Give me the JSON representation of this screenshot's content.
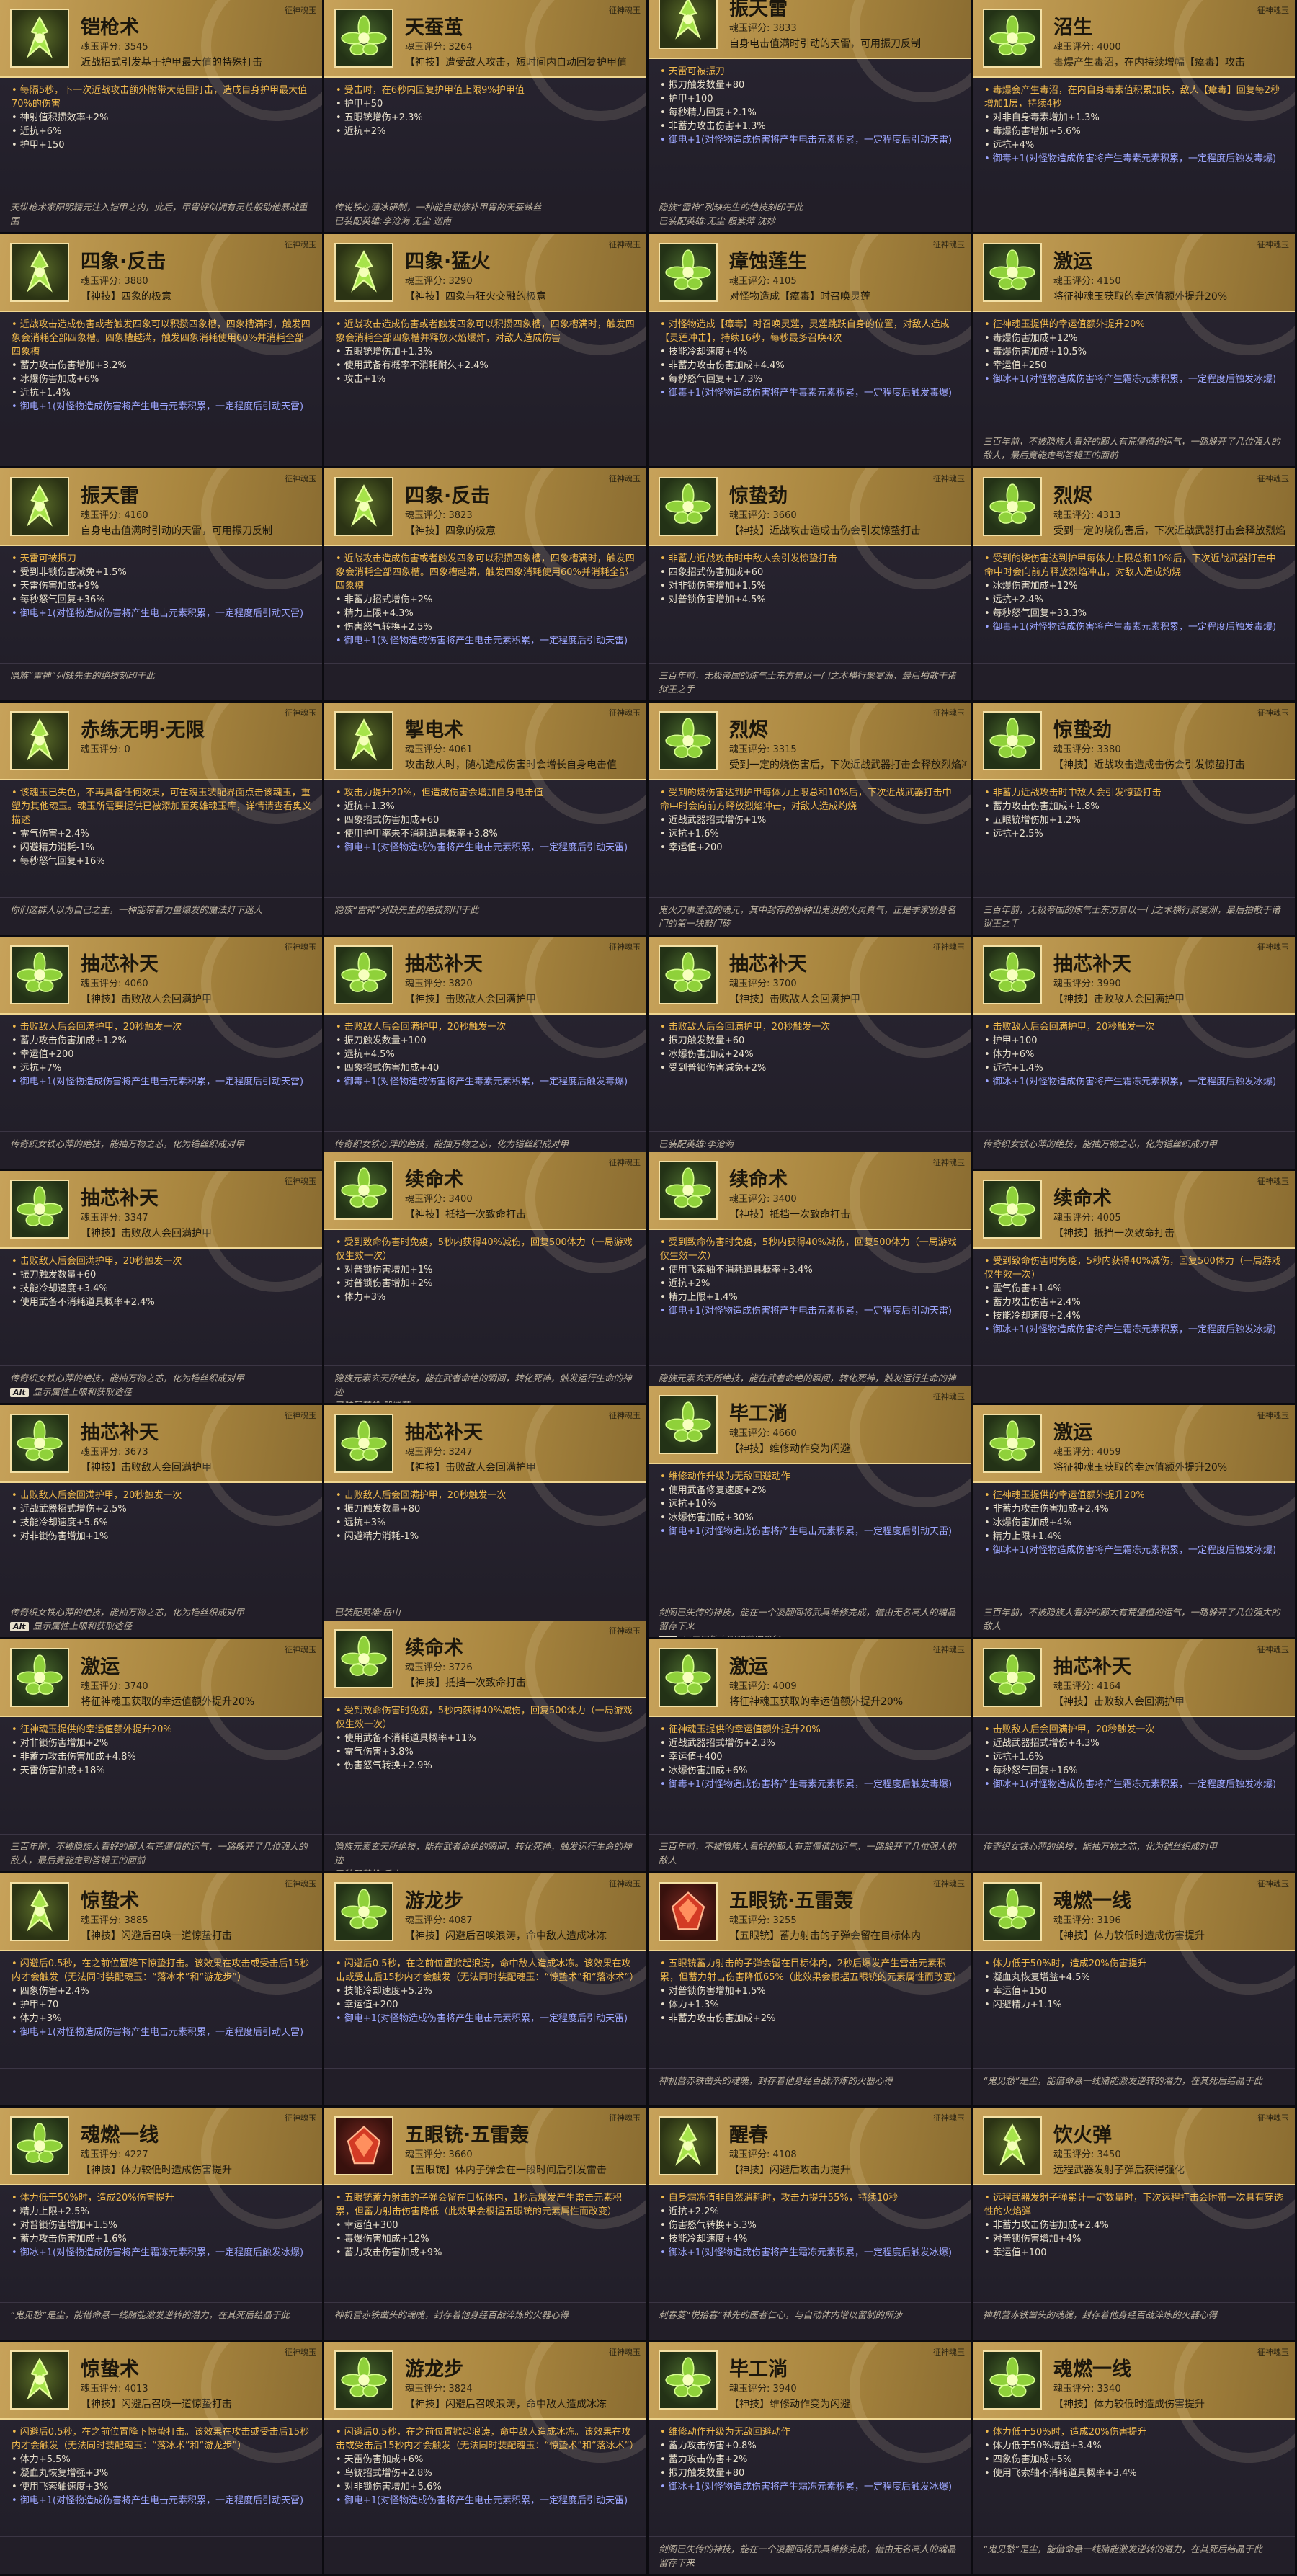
{
  "common": {
    "quality_tag": "征神魂玉",
    "alt_key": "Alt",
    "alt_hint": "显示属性上限和获取途径",
    "equip_prefix": "已装配英雄:"
  },
  "tiles": [
    {
      "name": "铠枪术",
      "score": "魂玉评分: 3545",
      "skill": "近战招式引发基于护甲最大值的特殊打击",
      "desc": "• 每隔5秒，下一次近战攻击额外附带大范围打击，造成自身护甲最大值70%的伤害",
      "lines": [
        "• 神射值积攒效率+2%",
        "• 近抗+6%",
        "• 护甲+150"
      ],
      "special": "",
      "lore": "天纵枪术家阳明精元注入铠甲之内，此后，甲胄好似拥有灵性般助他暴战重围",
      "icon": "spear"
    },
    {
      "name": "天蚕茧",
      "score": "魂玉评分: 3264",
      "skill": "【神技】遭受敌人攻击，短时间内自动回复护甲值",
      "desc": "• 受击时，在6秒内回复护甲值上限9%护甲值",
      "lines": [
        "• 护甲+50",
        "• 五眼铳增伤+2.3%",
        "• 近抗+2%"
      ],
      "special": "",
      "lore": "传说铁心薄冰研制，一种能自动修补甲胄的天蚕蛛丝",
      "equip": "李沧海 无尘 迦南",
      "icon": "flower"
    },
    {
      "name": "振天雷",
      "score": "魂玉评分: 3833",
      "skill": "自身电击值满时引动的天雷，可用振刀反制",
      "desc": "• 天雷可被振刀",
      "lines": [
        "• 振刀触发数量+80",
        "• 护甲+100",
        "• 每秒精力回复+2.1%",
        "• 非蓄力攻击伤害+1.3%"
      ],
      "special": "• 御电+1(对怪物造成伤害将产生电击元素积累，一定程度后引动天雷)",
      "lore": "隐族“雷神”列缺先生的绝技刻印于此",
      "equip": "无尘 殷紫萍 沈妙",
      "icon": "spear",
      "shift": true
    },
    {
      "name": "沼生",
      "score": "魂玉评分: 4000",
      "skill": "毒爆产生毒沼，在内持续增幅【瘴毒】攻击",
      "desc": "• 毒爆会产生毒沼，在内自身毒素值积累加快，敌人【瘴毒】回复每2秒增加1层，持续4秒",
      "lines": [
        "• 对非自身毒素增加+1.3%",
        "• 毒爆伤害增加+5.6%",
        "• 远抗+4%"
      ],
      "special": "• 御毒+1(对怪物造成伤害将产生毒素元素积累，一定程度后触发毒爆)",
      "lore": "",
      "icon": "flower"
    },
    {
      "name": "四象·反击",
      "score": "魂玉评分: 3880",
      "skill": "【神技】四象的极意",
      "desc": "• 近战攻击造成伤害或者触发四象可以积攒四象槽，四象槽满时，触发四象会消耗全部四象槽。四象槽越满，触发四象消耗使用60%并消耗全部四象槽",
      "lines": [
        "• 蓄力攻击伤害增加+3.2%",
        "• 冰爆伤害加成+6%",
        "• 近抗+1.4%"
      ],
      "special": "• 御电+1(对怪物造成伤害将产生电击元素积累，一定程度后引动天雷)",
      "lore": "",
      "icon": "spear"
    },
    {
      "name": "四象·猛火",
      "score": "魂玉评分: 3290",
      "skill": "【神技】四象与狂火交融的极意",
      "desc": "• 近战攻击造成伤害或者触发四象可以积攒四象槽，四象槽满时，触发四象会消耗全部四象槽并释放火焰爆炸，对敌人造成伤害",
      "lines": [
        "• 五眼铳增伤加+1.3%",
        "• 使用武备有概率不消耗耐久+2.4%",
        "• 攻击+1%"
      ],
      "special": "",
      "lore": "",
      "icon": "spear"
    },
    {
      "name": "瘴蚀莲生",
      "score": "魂玉评分: 4105",
      "skill": "对怪物造成【瘴毒】时召唤灵莲",
      "desc": "• 对怪物造成【瘴毒】时召唤灵莲，灵莲跳跃自身的位置，对敌人造成【灵莲冲击】，持续16秒，每秒最多召唤4次",
      "lines": [
        "• 技能冷却速度+4%",
        "• 非蓄力攻击伤害加成+4.4%",
        "• 每秒怒气回复+17.3%"
      ],
      "special": "• 御毒+1(对怪物造成伤害将产生毒素元素积累，一定程度后触发毒爆)",
      "lore": "",
      "icon": "flower"
    },
    {
      "name": "激运",
      "score": "魂玉评分: 4150",
      "skill": "将征神魂玉获取的幸运值额外提升20%",
      "desc": "• 征神魂玉提供的幸运值额外提升20%",
      "lines": [
        "• 毒爆伤害加成+12%",
        "• 毒爆伤害加成+10.5%",
        "• 幸运值+250"
      ],
      "special": "• 御冰+1(对怪物造成伤害将产生霜冻元素积累，一定程度后触发冰爆)",
      "lore": "三百年前，不被隐族人看好的鄙大有荒僵值的运气，一路躲开了几位强大的敌人，最后竟能走到答镜王的面前",
      "icon": "flower"
    },
    {
      "name": "振天雷",
      "score": "魂玉评分: 4160",
      "skill": "自身电击值满时引动的天雷，可用振刀反制",
      "desc": "• 天雷可被振刀",
      "lines": [
        "• 受到非锁伤害减免+1.5%",
        "• 天雷伤害加成+9%",
        "• 每秒怒气回复+36%"
      ],
      "special": "• 御电+1(对怪物造成伤害将产生电击元素积累，一定程度后引动天雷)",
      "lore": "隐族“雷神”列缺先生的绝技刻印于此",
      "icon": "spear"
    },
    {
      "name": "四象·反击",
      "score": "魂玉评分: 3823",
      "skill": "【神技】四象的极意",
      "desc": "• 近战攻击造成伤害或者触发四象可以积攒四象槽，四象槽满时，触发四象会消耗全部四象槽。四象槽越满，触发四象消耗使用60%并消耗全部四象槽",
      "lines": [
        "• 非蓄力招式增伤+2%",
        "• 精力上限+4.3%",
        "• 伤害怒气转换+2.5%"
      ],
      "special": "• 御电+1(对怪物造成伤害将产生电击元素积累，一定程度后引动天雷)",
      "lore": "",
      "icon": "spear"
    },
    {
      "name": "惊蛰劲",
      "score": "魂玉评分: 3660",
      "skill": "【神技】近战攻击造成击伤会引发惊蛰打击",
      "desc": "• 非蓄力近战攻击时中敌人会引发惊蛰打击",
      "lines": [
        "• 四象招式伤害加成+60",
        "• 对非锁伤害增加+1.5%",
        "• 对普锁伤害增加+4.5%"
      ],
      "special": "",
      "lore": "三百年前，无极帝国的炼气士东方景以一门之术横行聚宴洲，最后拍散于诸狱王之手",
      "icon": "flower"
    },
    {
      "name": "烈烬",
      "score": "魂玉评分: 4313",
      "skill": "受到一定的烧伤害后，下次近战武器打击会释放烈焰",
      "desc": "• 受到的烧伤害达到护甲每体力上限总和10%后，下次近战武器打击中命中时会向前方释放烈焰冲击，对敌人造成灼烧",
      "lines": [
        "• 冰爆伤害加成+12%",
        "• 远抗+2.4%",
        "• 每秒怒气回复+33.3%"
      ],
      "special": "• 御毒+1(对怪物造成伤害将产生毒素元素积累，一定程度后触发毒爆)",
      "lore": "",
      "icon": "flower"
    },
    {
      "name": "赤练无明·无限",
      "score": "魂玉评分: 0",
      "skill": "",
      "desc": "• 该魂玉已失色，不再具备任何效果，可在魂玉装配界面点击该魂玉，重塑为其他魂玉。魂玉所需要提供已被添加至英雄魂玉库，详情请查看奥义描述",
      "lines": [
        "• 霊气伤害+2.4%",
        "• 闪避精力消耗-1%",
        "• 每秒怒气回复+16%"
      ],
      "special": "",
      "lore": "你们这群人以为自己之主，一种能带着力量爆发的魔法灯下迷人",
      "icon": "spear"
    },
    {
      "name": "掣电术",
      "score": "魂玉评分: 4061",
      "skill": "攻击敌人时，随机造成伤害时会增长自身电击值",
      "desc": "• 攻击力提升20%，但造成伤害会增加自身电击值",
      "lines": [
        "• 近抗+1.3%",
        "• 四象招式伤害加成+60",
        "• 使用护甲率未不消耗道具概率+3.8%"
      ],
      "special": "• 御电+1(对怪物造成伤害将产生电击元素积累，一定程度后引动天雷)",
      "lore": "隐族“雷神”列缺先生的绝技刻印于此",
      "icon": "spear"
    },
    {
      "name": "烈烬",
      "score": "魂玉评分: 3315",
      "skill": "受到一定的烧伤害后，下次近战武器打击会释放烈焰冲击",
      "desc": "• 受到的烧伤害达到护甲每体力上限总和10%后，下次近战武器打击中命中时会向前方释放烈焰冲击，对敌人造成灼烧",
      "lines": [
        "• 近战武器招式增伤+1%",
        "• 远抗+1.6%",
        "• 幸运值+200"
      ],
      "special": "",
      "lore": "鬼火刀事遗流的魂元，其中封存的那种出鬼没的火灵真气，正是季家骄身名门的第一块敲门砖",
      "icon": "flower"
    },
    {
      "name": "惊蛰劲",
      "score": "魂玉评分: 3380",
      "skill": "【神技】近战攻击造成击伤会引发惊蛰打击",
      "desc": "• 非蓄力近战攻击时中敌人会引发惊蛰打击",
      "lines": [
        "• 蓄力攻击伤害加成+1.8%",
        "• 五眼铳增伤加+1.2%",
        "• 远抗+2.5%"
      ],
      "special": "",
      "lore": "三百年前，无极帝国的炼气士东方景以一门之术横行聚宴洲，最后拍散于诸狱王之手",
      "icon": "flower"
    },
    {
      "name": "抽芯补天",
      "score": "魂玉评分: 4060",
      "skill": "【神技】击败敌人会回满护甲",
      "desc": "• 击败敌人后会回满护甲，20秒触发一次",
      "lines": [
        "• 蓄力攻击伤害加成+1.2%",
        "• 幸运值+200",
        "• 远抗+7%"
      ],
      "special": "• 御电+1(对怪物造成伤害将产生电击元素积累，一定程度后引动天雷)",
      "lore": "传奇织女铁心萍的绝技，能抽万物之芯，化为铠丝织成对甲",
      "icon": "flower"
    },
    {
      "name": "抽芯补天",
      "score": "魂玉评分: 3820",
      "skill": "【神技】击败敌人会回满护甲",
      "desc": "• 击败敌人后会回满护甲，20秒触发一次",
      "lines": [
        "• 振刀触发数量+100",
        "• 远抗+4.5%",
        "• 四象招式伤害加成+40"
      ],
      "special": "• 御毒+1(对怪物造成伤害将产生毒素元素积累，一定程度后触发毒爆)",
      "lore": "传奇织女铁心萍的绝技，能抽万物之芯，化为铠丝织成对甲",
      "icon": "flower"
    },
    {
      "name": "抽芯补天",
      "score": "魂玉评分: 3700",
      "skill": "【神技】击败敌人会回满护甲",
      "desc": "• 击败敌人后会回满护甲，20秒触发一次",
      "lines": [
        "• 振刀触发数量+60",
        "• 冰爆伤害加成+24%",
        "• 受到普锁伤害减免+2%"
      ],
      "special": "",
      "lore": "",
      "equip": "李沧海",
      "icon": "flower"
    },
    {
      "name": "抽芯补天",
      "score": "魂玉评分: 3990",
      "skill": "【神技】击败敌人会回满护甲",
      "desc": "• 击败敌人后会回满护甲，20秒触发一次",
      "lines": [
        "• 护甲+100",
        "• 体力+6%",
        "• 近抗+1.4%"
      ],
      "special": "• 御冰+1(对怪物造成伤害将产生霜冻元素积累，一定程度后触发冰爆)",
      "lore": "传奇织女铁心萍的绝技，能抽万物之芯，化为铠丝织成对甲",
      "icon": "flower"
    },
    {
      "name": "抽芯补天",
      "score": "魂玉评分: 3347",
      "skill": "【神技】击败敌人会回满护甲",
      "desc": "• 击败敌人后会回满护甲，20秒触发一次",
      "lines": [
        "• 振刀触发数量+60",
        "• 技能冷却速度+3.4%",
        "• 使用武备不消耗道具概率+2.4%"
      ],
      "special": "",
      "lore": "传奇织女铁心萍的绝技，能抽万物之芯，化为铠丝织成对甲",
      "alt": true,
      "icon": "flower"
    },
    {
      "name": "续命术",
      "score": "魂玉评分: 3400",
      "skill": "【神技】抵挡一次致命打击",
      "desc": "• 受到致命伤害时免疫，5秒内获得40%减伤，回复500体力（一局游戏仅生效一次）",
      "lines": [
        "• 对普锁伤害增加+1%",
        "• 对普锁伤害增加+2%",
        "• 体力+3%"
      ],
      "special": "",
      "lore": "隐族元素玄天所绝技，能在武者命绝的瞬间，转化死神，触发运行生命的神迹",
      "equip": "殷紫萍",
      "icon": "flower",
      "shift": true
    },
    {
      "name": "续命术",
      "score": "魂玉评分: 3400",
      "skill": "【神技】抵挡一次致命打击",
      "desc": "• 受到致命伤害时免疫，5秒内获得40%减伤，回复500体力（一局游戏仅生效一次）",
      "lines": [
        "• 使用飞索轴不消耗道具概率+3.4%",
        "• 近抗+2%",
        "• 精力上限+1.4%"
      ],
      "special": "• 御电+1(对怪物造成伤害将产生电击元素积累，一定程度后引动天雷)",
      "lore": "隐族元素玄天所绝技，能在武者命绝的瞬间，转化死神，触发运行生命的神迹",
      "equip": "宁红夜（其他方案） 土御门胡桃 迦南",
      "icon": "flower",
      "shift": true
    },
    {
      "name": "续命术",
      "score": "魂玉评分: 4005",
      "skill": "【神技】抵挡一次致命打击",
      "desc": "• 受到致命伤害时免疫，5秒内获得40%减伤，回复500体力（一局游戏仅生效一次）",
      "lines": [
        "• 霊气伤害+1.4%",
        "• 蓄力攻击伤害+2.4%",
        "• 技能冷却速度+2.4%"
      ],
      "special": "• 御冰+1(对怪物造成伤害将产生霜冻元素积累，一定程度后触发冰爆)",
      "lore": "",
      "icon": "flower"
    },
    {
      "name": "抽芯补天",
      "score": "魂玉评分: 3673",
      "skill": "【神技】击败敌人会回满护甲",
      "desc": "• 击败敌人后会回满护甲，20秒触发一次",
      "lines": [
        "• 近战武器招式增伤+2.5%",
        "• 技能冷却速度+5.6%",
        "• 对非锁伤害增加+1%"
      ],
      "special": "",
      "lore": "传奇织女铁心萍的绝技，能抽万物之芯，化为铠丝织成对甲",
      "alt": true,
      "icon": "flower"
    },
    {
      "name": "抽芯补天",
      "score": "魂玉评分: 3247",
      "skill": "【神技】击败敌人会回满护甲",
      "desc": "• 击败敌人后会回满护甲，20秒触发一次",
      "lines": [
        "• 振刀触发数量+80",
        "• 远抗+3%",
        "• 闪避精力消耗-1%"
      ],
      "special": "",
      "lore": "",
      "equip": "岳山",
      "icon": "flower"
    },
    {
      "name": "毕工淌",
      "score": "魂玉评分: 4660",
      "skill": "【神技】维修动作变为闪避",
      "desc": "• 维修动作升级为无敌回避动作",
      "lines": [
        "• 使用武备修复速度+2%",
        "• 远抗+10%",
        "• 冰爆伤害加成+30%"
      ],
      "special": "• 御电+1(对怪物造成伤害将产生电击元素积累，一定程度后引动天雷)",
      "lore": "剑阁已失传的神技，能在一个凌翻间将武具维修完成，借由无名高人的魂晶留存下来",
      "alt": true,
      "icon": "flower",
      "shift": true
    },
    {
      "name": "激运",
      "score": "魂玉评分: 4059",
      "skill": "将征神魂玉获取的幸运值额外提升20%",
      "desc": "• 征神魂玉提供的幸运值额外提升20%",
      "lines": [
        "• 非蓄力攻击伤害加成+2.4%",
        "• 冰爆伤害加成+4%",
        "• 精力上限+1.4%"
      ],
      "special": "• 御冰+1(对怪物造成伤害将产生霜冻元素积累，一定程度后触发冰爆)",
      "lore": "三百年前，不被隐族人看好的鄙大有荒僵值的运气，一路躲开了几位强大的敌人",
      "icon": "flower"
    },
    {
      "name": "激运",
      "score": "魂玉评分: 3740",
      "skill": "将征神魂玉获取的幸运值额外提升20%",
      "desc": "• 征神魂玉提供的幸运值额外提升20%",
      "lines": [
        "• 对非锁伤害增加+2%",
        "• 非蓄力攻击伤害加成+4.8%",
        "• 天雷伤害加成+18%"
      ],
      "special": "",
      "lore": "三百年前，不被隐族人看好的鄙大有荒僵值的运气，一路躲开了几位强大的敌人，最后竟能走到答镜王的面前",
      "icon": "flower"
    },
    {
      "name": "续命术",
      "score": "魂玉评分: 3726",
      "skill": "【神技】抵挡一次致命打击",
      "desc": "• 受到致命伤害时免疫，5秒内获得40%减伤，回复500体力（一局游戏仅生效一次）",
      "lines": [
        "• 使用武备不消耗道具概率+11%",
        "• 霊气伤害+3.8%",
        "• 伤害怒气转换+2.9%"
      ],
      "special": "",
      "lore": "隐族元素玄天所绝技，能在武者命绝的瞬间，转化死神，触发运行生命的神迹",
      "equip": "岳山",
      "icon": "flower",
      "shift": true
    },
    {
      "name": "激运",
      "score": "魂玉评分: 4009",
      "skill": "将征神魂玉获取的幸运值额外提升20%",
      "desc": "• 征神魂玉提供的幸运值额外提升20%",
      "lines": [
        "• 近战武器招式增伤+2.3%",
        "• 幸运值+400",
        "• 冰爆伤害加成+6%"
      ],
      "special": "• 御毒+1(对怪物造成伤害将产生毒素元素积累，一定程度后触发毒爆)",
      "lore": "三百年前，不被隐族人看好的鄙大有荒僵值的运气，一路躲开了几位强大的敌人",
      "icon": "flower"
    },
    {
      "name": "抽芯补天",
      "score": "魂玉评分: 4164",
      "skill": "【神技】击败敌人会回满护甲",
      "desc": "• 击败敌人后会回满护甲，20秒触发一次",
      "lines": [
        "• 近战武器招式增伤+4.3%",
        "• 远抗+1.6%",
        "• 每秒怒气回复+16%"
      ],
      "special": "• 御冰+1(对怪物造成伤害将产生霜冻元素积累，一定程度后触发冰爆)",
      "lore": "传奇织女铁心萍的绝技，能抽万物之芯，化为铠丝织成对甲",
      "icon": "flower"
    },
    {
      "name": "惊蛰术",
      "score": "魂玉评分: 3885",
      "skill": "【神技】闪避后召唤一道惊蛰打击",
      "desc": "• 闪避后0.5秒，在之前位置降下惊蛰打击。该效果在攻击或受击后15秒内才会触发（无法同时装配魂玉：“落冰术”和“游龙步”）",
      "lines": [
        "• 四象伤害+2.4%",
        "• 护甲+70",
        "• 体力+3%"
      ],
      "special": "• 御电+1(对怪物造成伤害将产生电击元素积累，一定程度后引动天雷)",
      "lore": "",
      "icon": "spear"
    },
    {
      "name": "游龙步",
      "score": "魂玉评分: 4087",
      "skill": "【神技】闪避后召唤浪涛，命中敌人造成冰冻",
      "desc": "• 闪避后0.5秒，在之前位置掀起浪涛，命中敌人造成冰冻。该效果在攻击或受击后15秒内才会触发（无法同时装配魂玉：“惊蛰术”和“落冰术”）",
      "lines": [
        "• 技能冷却速度+5.2%",
        "• 幸运值+200"
      ],
      "special": "• 御电+1(对怪物造成伤害将产生电击元素积累，一定程度后引动天雷)",
      "lore": "",
      "icon": "flower"
    },
    {
      "name": "五眼铳·五雷轰",
      "score": "魂玉评分: 3255",
      "skill": "【五眼铳】蓄力射击的子弹会留在目标体内",
      "desc": "• 五眼铳蓄力射击的子弹会留在目标体内，2秒后爆发产生雷击元素积累，但蓄力射击伤害降低65%（此效果会根据五眼铳的元素属性而改变）",
      "lines": [
        "• 对普锁伤害增加+1.5%",
        "• 体力+1.3%",
        "• 非蓄力攻击伤害加成+2%"
      ],
      "special": "",
      "lore": "神机营赤铁凿头的魂魄，封存着他身经百战淬炼的火器心得",
      "icon": "gem"
    },
    {
      "name": "魂燃一线",
      "score": "魂玉评分: 3196",
      "skill": "【神技】体力较低时造成伤害提升",
      "desc": "• 体力低于50%时，造成20%伤害提升",
      "lines": [
        "• 凝血丸恢复增益+4.5%",
        "• 幸运值+150",
        "• 闪避精力+1.1%"
      ],
      "special": "",
      "lore": "“鬼见愁”是尘，能借命悬一线赌能激发逆转的潜力，在其死后结晶于此",
      "equip": "",
      "icon": "flower"
    },
    {
      "name": "魂燃一线",
      "score": "魂玉评分: 4227",
      "skill": "【神技】体力较低时造成伤害提升",
      "desc": "• 体力低于50%时，造成20%伤害提升",
      "lines": [
        "• 精力上限+2.5%",
        "• 对普锁伤害增加+1.5%",
        "• 蓄力攻击伤害加成+1.6%"
      ],
      "special": "• 御冰+1(对怪物造成伤害将产生霜冻元素积累，一定程度后触发冰爆)",
      "lore": "“鬼见愁”是尘，能借命悬一线赌能激发逆转的潜力，在其死后结晶于此",
      "icon": "flower"
    },
    {
      "name": "五眼铳·五雷轰",
      "score": "魂玉评分: 3660",
      "skill": "【五眼铳】体内子弹会在一段时间后引发雷击",
      "desc": "• 五眼铳蓄力射击的子弹会留在目标体内，1秒后爆发产生雷击元素积累，但蓄力射击伤害降低（此效果会根据五眼铳的元素属性而改变）",
      "lines": [
        "• 幸运值+300",
        "• 毒爆伤害加成+12%",
        "• 蓄力攻击伤害加成+9%"
      ],
      "special": "",
      "lore": "神机营赤铁凿头的魂魄，封存着他身经百战淬炼的火器心得",
      "icon": "gem"
    },
    {
      "name": "醒春",
      "score": "魂玉评分: 4108",
      "skill": "【神技】闪避后攻击力提升",
      "desc": "• 自身霜冻值非自然消耗时，攻击力提升55%，持续10秒",
      "lines": [
        "• 近抗+2.2%",
        "• 伤害怒气转换+5.3%",
        "• 技能冷却速度+4%"
      ],
      "special": "• 御冰+1(对怪物造成伤害将产生霜冻元素积累，一定程度后触发冰爆)",
      "lore": "刺春菱“悦拾春”林先的医者仁心，与自动体内增以留制的所涉",
      "icon": "spear"
    },
    {
      "name": "饮火弹",
      "score": "魂玉评分: 3450",
      "skill": "远程武器发射子弹后获得强化",
      "desc": "• 远程武器发射子弹累计一定数量时，下次远程打击会附带一次具有穿透性的火焰弹",
      "lines": [
        "• 非蓄力攻击伤害加成+2.4%",
        "• 对普锁伤害增加+4%",
        "• 幸运值+100"
      ],
      "special": "",
      "lore": "神机营赤铁凿头的魂魄，封存着他身经百战淬炼的火器心得",
      "icon": "spear"
    },
    {
      "name": "惊蛰术",
      "score": "魂玉评分: 4013",
      "skill": "【神技】闪避后召唤一道惊蛰打击",
      "desc": "• 闪避后0.5秒，在之前位置降下惊蛰打击。该效果在攻击或受击后15秒内才会触发（无法同时装配魂玉：“落冰术”和“游龙步”）",
      "lines": [
        "• 体力+5.5%",
        "• 凝血丸恢复增强+3%",
        "• 使用飞索轴速度+3%"
      ],
      "special": "• 御电+1(对怪物造成伤害将产生电击元素积累，一定程度后引动天雷)",
      "lore": "",
      "icon": "spear"
    },
    {
      "name": "游龙步",
      "score": "魂玉评分: 3824",
      "skill": "【神技】闪避后召唤浪涛，命中敌人造成冰冻",
      "desc": "• 闪避后0.5秒，在之前位置掀起浪涛，命中敌人造成冰冻。该效果在攻击或受击后15秒内才会触发（无法同时装配魂玉：“惊蛰术”和“落冰术”）",
      "lines": [
        "• 天雷伤害加成+6%",
        "• 鸟铳招式增伤+2.8%",
        "• 对非锁伤害增加+5.6%"
      ],
      "special": "• 御电+1(对怪物造成伤害将产生电击元素积累，一定程度后引动天雷)",
      "lore": "",
      "icon": "flower"
    },
    {
      "name": "毕工淌",
      "score": "魂玉评分: 3940",
      "skill": "【神技】维修动作变为闪避",
      "desc": "• 维修动作升级为无敌回避动作",
      "lines": [
        "• 蓄力攻击伤害+0.8%",
        "• 蓄力攻击伤害+2%",
        "• 振刀触发数量+80"
      ],
      "special": "• 御冰+1(对怪物造成伤害将产生霜冻元素积累，一定程度后触发冰爆)",
      "lore": "剑阁已失传的神技，能在一个凌翻间将武具维修完成，借由无名高人的魂晶留存下来",
      "icon": "flower"
    },
    {
      "name": "魂燃一线",
      "score": "魂玉评分: 3340",
      "skill": "【神技】体力较低时造成伤害提升",
      "desc": "• 体力低于50%时，造成20%伤害提升",
      "lines": [
        "• 体力低于50%增益+3.4%",
        "• 四象伤害加成+5%",
        "• 使用飞索轴不消耗道具概率+3.4%"
      ],
      "special": "",
      "lore": "“鬼见愁”是尘，能借命悬一线赌能激发逆转的潜力，在其死后结晶于此",
      "icon": "flower"
    }
  ]
}
